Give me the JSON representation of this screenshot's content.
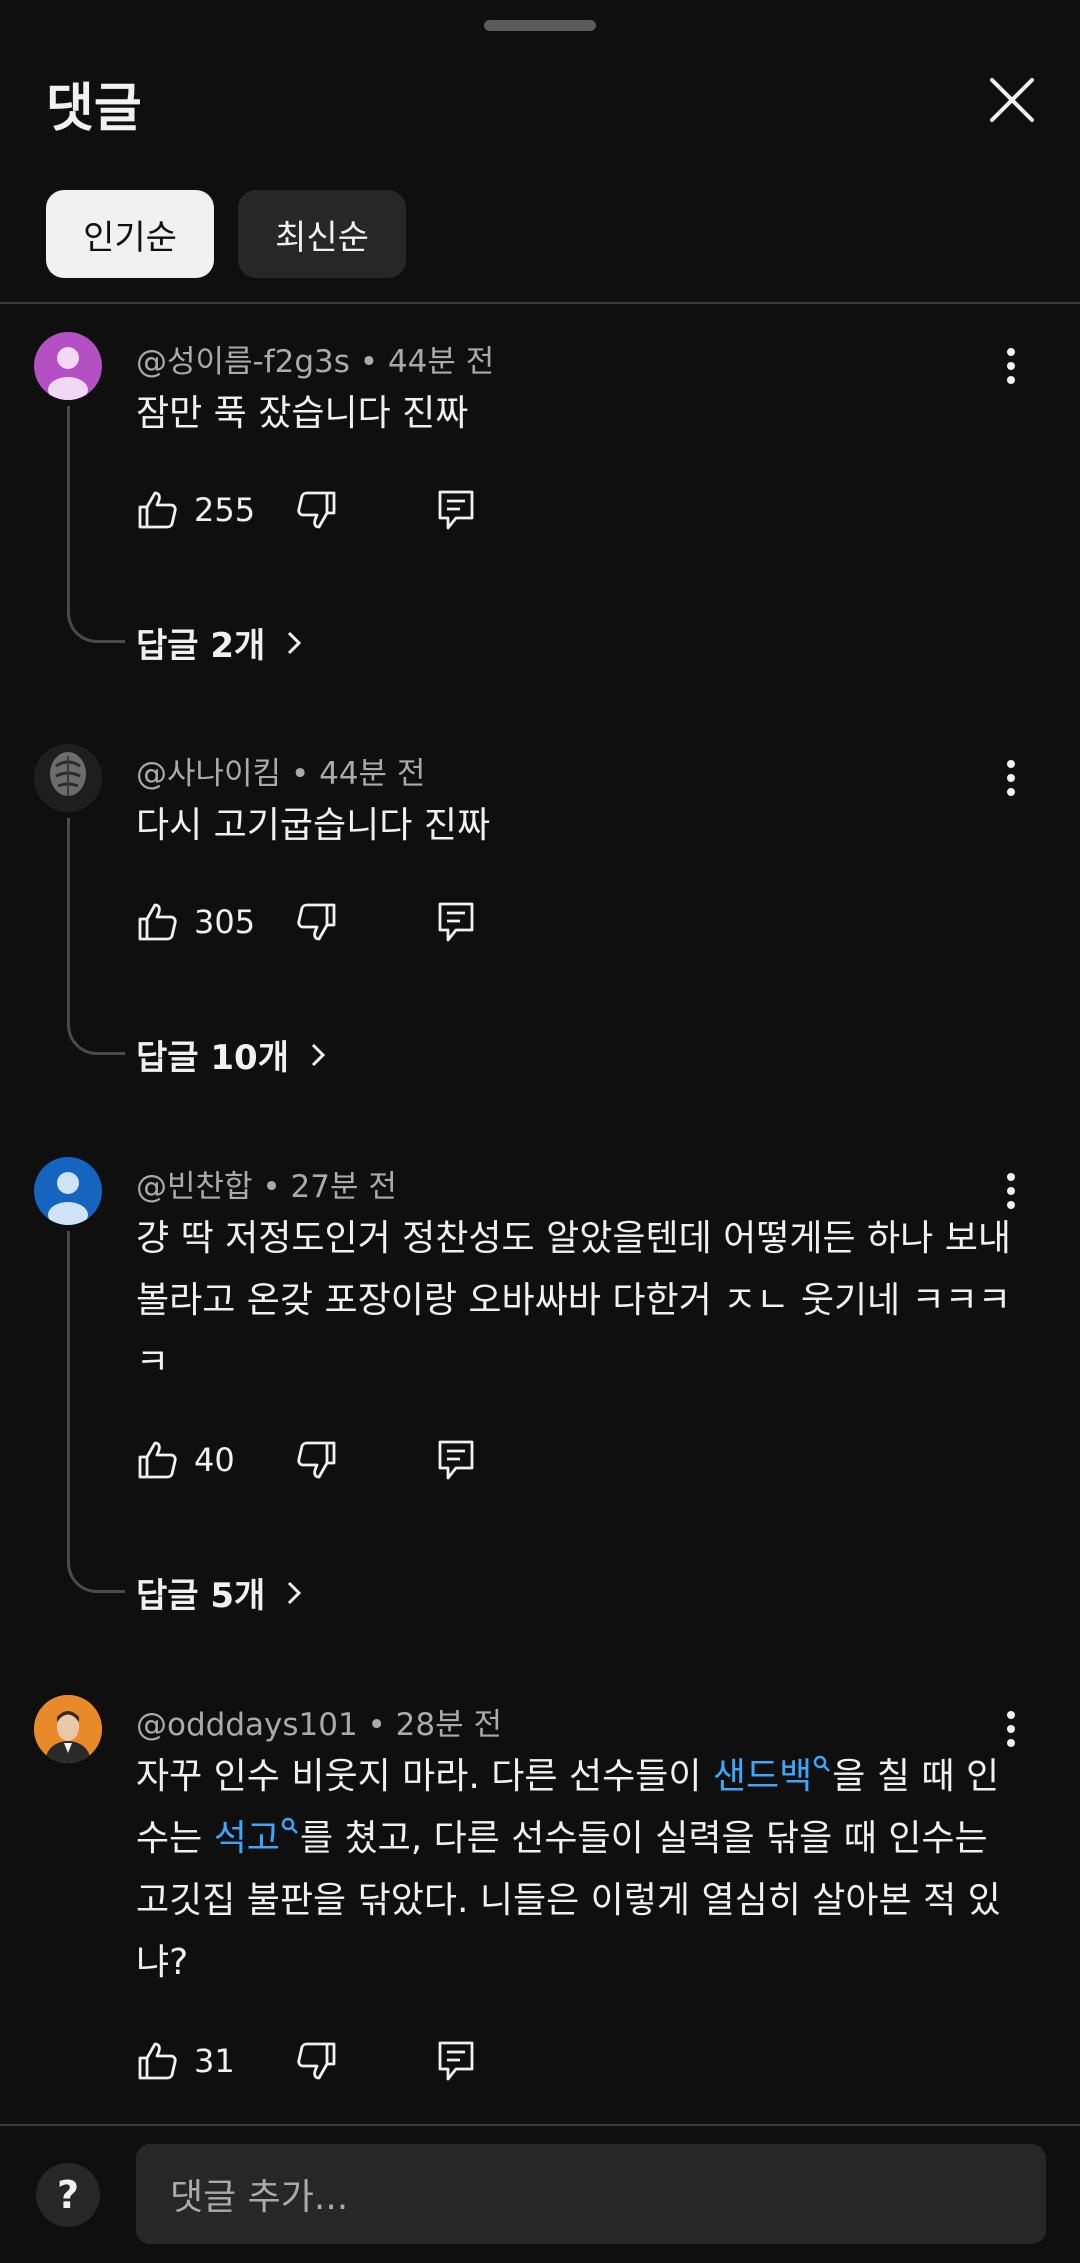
{
  "header": {
    "title": "댓글"
  },
  "sort": {
    "popular": "인기순",
    "latest": "최신순"
  },
  "colors": {
    "background": "#0f0f0f",
    "link": "#3ea6ff",
    "chip_active": "#f1f1f1"
  },
  "comments": [
    {
      "author": "@성이름-f2g3s",
      "time": "• 44분 전",
      "text": "잠만 푹 잤습니다 진짜",
      "likes": "255",
      "replies": "답글 2개"
    },
    {
      "author": "@사나이킴",
      "time": "• 44분 전",
      "text": "다시 고기굽습니다 진짜",
      "likes": "305",
      "replies": "답글 10개"
    },
    {
      "author": "@빈찬합",
      "time": "• 27분 전",
      "text": "걍 딱 저정도인거 정찬성도 알았을텐데 어떻게든 하나 보내볼라고 온갖 포장이랑 오바싸바 다한거 ㅈㄴ 웃기네 ㅋㅋㅋㅋ",
      "likes": "40",
      "replies": "답글 5개"
    },
    {
      "author": "@odddays101",
      "time": "• 28분 전",
      "text_parts": [
        "자꾸 인수 비웃지 마라. 다른 선수들이 ",
        "샌드백",
        "을 칠 때 인수는 ",
        "석고",
        "를 쳤고, 다른 선수들이 실력을 닦을 때 인수는 고깃집 불판을 닦았다. 니들은 이렇게 열심히 살아본 적 있냐?"
      ],
      "likes": "31"
    }
  ],
  "footer": {
    "help": "?",
    "input_placeholder": "댓글 추가..."
  },
  "icons": [
    "close-icon",
    "kebab-icon",
    "like-icon",
    "dislike-icon",
    "reply-icon",
    "search-link-icon",
    "chevron-right-icon",
    "help-icon"
  ]
}
